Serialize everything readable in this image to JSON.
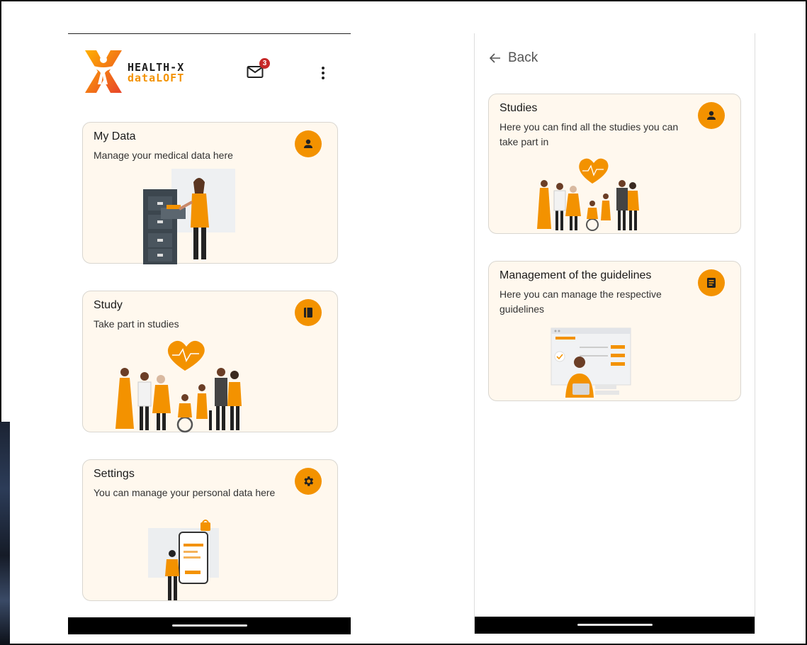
{
  "app": {
    "logo_line1": "HEALTH-X",
    "logo_line2": "dataLOFT",
    "unread_count": "3"
  },
  "home": {
    "cards": [
      {
        "title": "My Data",
        "description": "Manage your medical data here",
        "icon": "person-icon"
      },
      {
        "title": "Study",
        "description": "Take part in studies",
        "icon": "book-icon"
      },
      {
        "title": "Settings",
        "description": "You can manage your personal data here",
        "icon": "gear-icon"
      }
    ]
  },
  "detail": {
    "back_label": "Back",
    "cards": [
      {
        "title": "Studies",
        "description": "Here you can find all the studies you can take part in",
        "icon": "person-icon"
      },
      {
        "title": "Management of the guidelines",
        "description": "Here you can manage the respective guidelines",
        "icon": "document-list-icon"
      }
    ]
  },
  "colors": {
    "accent": "#f39200",
    "card_background": "#fff8ee",
    "badge": "#c62828",
    "nav_bar": "#000000"
  }
}
